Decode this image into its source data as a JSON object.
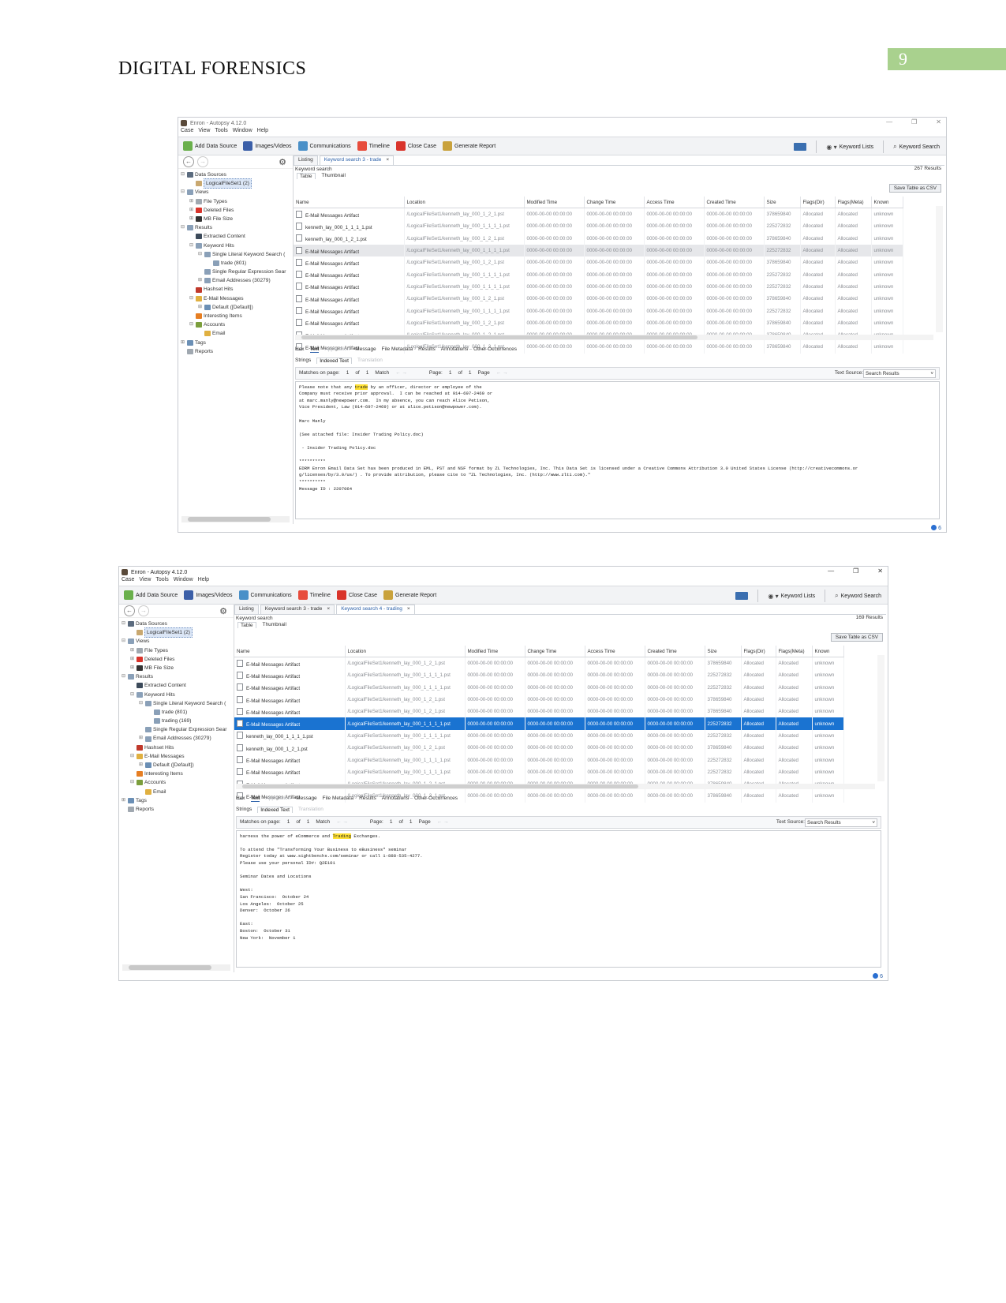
{
  "header": {
    "title": "DIGITAL FORENSICS",
    "page_number": "9"
  },
  "menu": [
    "Case",
    "View",
    "Tools",
    "Window",
    "Help"
  ],
  "toolbar": {
    "add_data_source": "Add Data Source",
    "images_videos": "Images/Videos",
    "communications": "Communications",
    "timeline": "Timeline",
    "close_case": "Close Case",
    "generate_report": "Generate Report",
    "keyword_lists": "Keyword Lists",
    "keyword_search": "Keyword Search"
  },
  "columns": [
    "Name",
    "Location",
    "Modified Time",
    "Change Time",
    "Access Time",
    "Created Time",
    "Size",
    "Flags(Dir)",
    "Flags(Meta)",
    "Known"
  ],
  "common": {
    "keyword_search_label": "Keyword search",
    "table_tab": "Table",
    "thumbnail_tab": "Thumbnail",
    "save_csv": "Save Table as CSV",
    "lower_tabs": [
      "Hex",
      "Text",
      "Application",
      "Message",
      "File Metadata",
      "Results",
      "Annotations",
      "Other Occurrences"
    ],
    "inner_tabs": [
      "Strings",
      "Indexed Text",
      "Translation"
    ],
    "matches_label": "Matches on page:",
    "of": "of",
    "match": "Match",
    "page_label": "Page:",
    "page_word": "Page",
    "text_source_label": "Text Source:",
    "text_source_value": "Search Results",
    "status_count": "6"
  },
  "screenshot1": {
    "window_title": "Enron - Autopsy 4.12.0",
    "tabs": [
      {
        "label": "Listing",
        "active": false,
        "closable": false
      },
      {
        "label": "Keyword search 3 - trade",
        "active": true,
        "closable": true
      }
    ],
    "results_count": "267  Results",
    "tree": [
      {
        "level": 0,
        "toggle": "⊟",
        "label": "Data Sources",
        "icon": "#5b6b7e"
      },
      {
        "level": 1,
        "toggle": "",
        "label": "LogicalFileSet1 (2)",
        "icon": "#c9a870",
        "selected": true
      },
      {
        "level": 0,
        "toggle": "⊟",
        "label": "Views",
        "icon": "#8aa0b8"
      },
      {
        "level": 1,
        "toggle": "⊞",
        "label": "File Types",
        "icon": "#a0a8b0"
      },
      {
        "level": 1,
        "toggle": "⊞",
        "label": "Deleted Files",
        "icon": "#d9342b"
      },
      {
        "level": 1,
        "toggle": "⊞",
        "label": "MB File Size",
        "icon": "#333"
      },
      {
        "level": 0,
        "toggle": "⊟",
        "label": "Results",
        "icon": "#8aa0b8"
      },
      {
        "level": 1,
        "toggle": "",
        "label": "Extracted Content",
        "icon": "#3c4a5a"
      },
      {
        "level": 1,
        "toggle": "⊟",
        "label": "Keyword Hits",
        "icon": "#8aa0b8"
      },
      {
        "level": 2,
        "toggle": "⊟",
        "label": "Single Literal Keyword Search (",
        "icon": "#8aa0b8"
      },
      {
        "level": 3,
        "toggle": "",
        "label": "trade (801)",
        "icon": "#8aa0b8"
      },
      {
        "level": 2,
        "toggle": "",
        "label": "Single Regular Expression Sear",
        "icon": "#8aa0b8"
      },
      {
        "level": 2,
        "toggle": "⊞",
        "label": "Email Addresses (30279)",
        "icon": "#8aa0b8"
      },
      {
        "level": 1,
        "toggle": "",
        "label": "Hashset Hits",
        "icon": "#c0392b"
      },
      {
        "level": 1,
        "toggle": "⊟",
        "label": "E-Mail Messages",
        "icon": "#e0b040"
      },
      {
        "level": 2,
        "toggle": "⊞",
        "label": "Default ([Default])",
        "icon": "#6b8fb5"
      },
      {
        "level": 1,
        "toggle": "",
        "label": "Interesting Items",
        "icon": "#e67e22"
      },
      {
        "level": 1,
        "toggle": "⊟",
        "label": "Accounts",
        "icon": "#7b9e3c"
      },
      {
        "level": 2,
        "toggle": "",
        "label": "Email",
        "icon": "#e0b040"
      },
      {
        "level": 0,
        "toggle": "⊞",
        "label": "Tags",
        "icon": "#6b8fb5"
      },
      {
        "level": 0,
        "toggle": "",
        "label": "Reports",
        "icon": "#a0a8b0"
      }
    ],
    "rows": [
      {
        "name": "E-Mail Messages Artifact",
        "location": "/LogicalFileSet1/kenneth_lay_000_1_2_1.pst",
        "modified": "0000-00-00 00:00:00",
        "change": "0000-00-00 00:00:00",
        "access": "0000-00-00 00:00:00",
        "created": "0000-00-00 00:00:00",
        "size": "378659840",
        "flags_dir": "Allocated",
        "flags_meta": "Allocated",
        "known": "unknown",
        "state": ""
      },
      {
        "name": "kenneth_lay_000_1_1_1_1.pst",
        "location": "/LogicalFileSet1/kenneth_lay_000_1_1_1_1.pst",
        "modified": "0000-00-00 00:00:00",
        "change": "0000-00-00 00:00:00",
        "access": "0000-00-00 00:00:00",
        "created": "0000-00-00 00:00:00",
        "size": "225272832",
        "flags_dir": "Allocated",
        "flags_meta": "Allocated",
        "known": "unknown",
        "state": ""
      },
      {
        "name": "kenneth_lay_000_1_2_1.pst",
        "location": "/LogicalFileSet1/kenneth_lay_000_1_2_1.pst",
        "modified": "0000-00-00 00:00:00",
        "change": "0000-00-00 00:00:00",
        "access": "0000-00-00 00:00:00",
        "created": "0000-00-00 00:00:00",
        "size": "378659840",
        "flags_dir": "Allocated",
        "flags_meta": "Allocated",
        "known": "unknown",
        "state": ""
      },
      {
        "name": "E-Mail Messages Artifact",
        "location": "/LogicalFileSet1/kenneth_lay_000_1_1_1_1.pst",
        "modified": "0000-00-00 00:00:00",
        "change": "0000-00-00 00:00:00",
        "access": "0000-00-00 00:00:00",
        "created": "0000-00-00 00:00:00",
        "size": "225272832",
        "flags_dir": "Allocated",
        "flags_meta": "Allocated",
        "known": "unknown",
        "state": "hl"
      },
      {
        "name": "E-Mail Messages Artifact",
        "location": "/LogicalFileSet1/kenneth_lay_000_1_2_1.pst",
        "modified": "0000-00-00 00:00:00",
        "change": "0000-00-00 00:00:00",
        "access": "0000-00-00 00:00:00",
        "created": "0000-00-00 00:00:00",
        "size": "378659840",
        "flags_dir": "Allocated",
        "flags_meta": "Allocated",
        "known": "unknown",
        "state": ""
      },
      {
        "name": "E-Mail Messages Artifact",
        "location": "/LogicalFileSet1/kenneth_lay_000_1_1_1_1.pst",
        "modified": "0000-00-00 00:00:00",
        "change": "0000-00-00 00:00:00",
        "access": "0000-00-00 00:00:00",
        "created": "0000-00-00 00:00:00",
        "size": "225272832",
        "flags_dir": "Allocated",
        "flags_meta": "Allocated",
        "known": "unknown",
        "state": ""
      },
      {
        "name": "E-Mail Messages Artifact",
        "location": "/LogicalFileSet1/kenneth_lay_000_1_1_1_1.pst",
        "modified": "0000-00-00 00:00:00",
        "change": "0000-00-00 00:00:00",
        "access": "0000-00-00 00:00:00",
        "created": "0000-00-00 00:00:00",
        "size": "225272832",
        "flags_dir": "Allocated",
        "flags_meta": "Allocated",
        "known": "unknown",
        "state": ""
      },
      {
        "name": "E-Mail Messages Artifact",
        "location": "/LogicalFileSet1/kenneth_lay_000_1_2_1.pst",
        "modified": "0000-00-00 00:00:00",
        "change": "0000-00-00 00:00:00",
        "access": "0000-00-00 00:00:00",
        "created": "0000-00-00 00:00:00",
        "size": "378659840",
        "flags_dir": "Allocated",
        "flags_meta": "Allocated",
        "known": "unknown",
        "state": ""
      },
      {
        "name": "E-Mail Messages Artifact",
        "location": "/LogicalFileSet1/kenneth_lay_000_1_1_1_1.pst",
        "modified": "0000-00-00 00:00:00",
        "change": "0000-00-00 00:00:00",
        "access": "0000-00-00 00:00:00",
        "created": "0000-00-00 00:00:00",
        "size": "225272832",
        "flags_dir": "Allocated",
        "flags_meta": "Allocated",
        "known": "unknown",
        "state": ""
      },
      {
        "name": "E-Mail Messages Artifact",
        "location": "/LogicalFileSet1/kenneth_lay_000_1_2_1.pst",
        "modified": "0000-00-00 00:00:00",
        "change": "0000-00-00 00:00:00",
        "access": "0000-00-00 00:00:00",
        "created": "0000-00-00 00:00:00",
        "size": "378659840",
        "flags_dir": "Allocated",
        "flags_meta": "Allocated",
        "known": "unknown",
        "state": ""
      },
      {
        "name": "E-Mail Messages Artifact",
        "location": "/LogicalFileSet1/kenneth_lay_000_1_2_1.pst",
        "modified": "0000-00-00 00:00:00",
        "change": "0000-00-00 00:00:00",
        "access": "0000-00-00 00:00:00",
        "created": "0000-00-00 00:00:00",
        "size": "378659840",
        "flags_dir": "Allocated",
        "flags_meta": "Allocated",
        "known": "unknown",
        "state": ""
      },
      {
        "name": "E-Mail Messages Artifact",
        "location": "/LogicalFileSet1/kenneth_lay_000_1_2_1.pst",
        "modified": "0000-00-00 00:00:00",
        "change": "0000-00-00 00:00:00",
        "access": "0000-00-00 00:00:00",
        "created": "0000-00-00 00:00:00",
        "size": "378659840",
        "flags_dir": "Allocated",
        "flags_meta": "Allocated",
        "known": "unknown",
        "state": ""
      }
    ],
    "matches": {
      "current": "1",
      "total": "1"
    },
    "page": {
      "current": "1",
      "total": "1"
    },
    "text_before": "Please note that any ",
    "highlight": "trade",
    "text_after": " by an officer, director or employee of the\nCompany must receive prior approval.  I can be reached at 914-697-2460 or\nat marc.manly@newpower.com.  In my absence, you can reach Alice Petison,\nVice President, Law (914-697-2469) or at alice.petison@newpower.com).\n\nMarc Manly\n\n(See attached file: Insider Trading Policy.doc)\n\n - Insider Trading Policy.doc\n\n**********\nEDRM Enron Email Data Set has been produced in EML, PST and NSF format by ZL Technologies, Inc. This Data Set is licensed under a Creative Commons Attribution 3.0 United States License (http://creativecommons.or\ng/licenses/by/3.0/us/) . To provide attribution, please cite to \"ZL Technologies, Inc. (http://www.zlti.com).\"\n**********\nMessage ID : 2207064"
  },
  "screenshot2": {
    "window_title": "Enron - Autopsy 4.12.0",
    "tabs": [
      {
        "label": "Listing",
        "active": false,
        "closable": false
      },
      {
        "label": "Keyword search 3 - trade",
        "active": false,
        "closable": true
      },
      {
        "label": "Keyword search 4 - trading",
        "active": true,
        "closable": true
      }
    ],
    "results_count": "169  Results",
    "tree": [
      {
        "level": 0,
        "toggle": "⊟",
        "label": "Data Sources",
        "icon": "#5b6b7e"
      },
      {
        "level": 1,
        "toggle": "",
        "label": "LogicalFileSet1 (2)",
        "icon": "#c9a870",
        "selected": true
      },
      {
        "level": 0,
        "toggle": "⊟",
        "label": "Views",
        "icon": "#8aa0b8"
      },
      {
        "level": 1,
        "toggle": "⊞",
        "label": "File Types",
        "icon": "#a0a8b0"
      },
      {
        "level": 1,
        "toggle": "⊞",
        "label": "Deleted Files",
        "icon": "#d9342b"
      },
      {
        "level": 1,
        "toggle": "⊞",
        "label": "MB File Size",
        "icon": "#333"
      },
      {
        "level": 0,
        "toggle": "⊟",
        "label": "Results",
        "icon": "#8aa0b8"
      },
      {
        "level": 1,
        "toggle": "",
        "label": "Extracted Content",
        "icon": "#3c4a5a"
      },
      {
        "level": 1,
        "toggle": "⊟",
        "label": "Keyword Hits",
        "icon": "#8aa0b8"
      },
      {
        "level": 2,
        "toggle": "⊟",
        "label": "Single Literal Keyword Search (",
        "icon": "#8aa0b8"
      },
      {
        "level": 3,
        "toggle": "",
        "label": "trade (801)",
        "icon": "#8aa0b8"
      },
      {
        "level": 3,
        "toggle": "",
        "label": "trading (169)",
        "icon": "#8aa0b8"
      },
      {
        "level": 2,
        "toggle": "",
        "label": "Single Regular Expression Sear",
        "icon": "#8aa0b8"
      },
      {
        "level": 2,
        "toggle": "⊞",
        "label": "Email Addresses (30279)",
        "icon": "#8aa0b8"
      },
      {
        "level": 1,
        "toggle": "",
        "label": "Hashset Hits",
        "icon": "#c0392b"
      },
      {
        "level": 1,
        "toggle": "⊟",
        "label": "E-Mail Messages",
        "icon": "#e0b040"
      },
      {
        "level": 2,
        "toggle": "⊞",
        "label": "Default ([Default])",
        "icon": "#6b8fb5"
      },
      {
        "level": 1,
        "toggle": "",
        "label": "Interesting Items",
        "icon": "#e67e22"
      },
      {
        "level": 1,
        "toggle": "⊟",
        "label": "Accounts",
        "icon": "#7b9e3c"
      },
      {
        "level": 2,
        "toggle": "",
        "label": "Email",
        "icon": "#e0b040"
      },
      {
        "level": 0,
        "toggle": "⊞",
        "label": "Tags",
        "icon": "#6b8fb5"
      },
      {
        "level": 0,
        "toggle": "",
        "label": "Reports",
        "icon": "#a0a8b0"
      }
    ],
    "rows": [
      {
        "name": "E-Mail Messages Artifact",
        "location": "/LogicalFileSet1/kenneth_lay_000_1_2_1.pst",
        "modified": "0000-00-00 00:00:00",
        "change": "0000-00-00 00:00:00",
        "access": "0000-00-00 00:00:00",
        "created": "0000-00-00 00:00:00",
        "size": "378659840",
        "flags_dir": "Allocated",
        "flags_meta": "Allocated",
        "known": "unknown",
        "state": ""
      },
      {
        "name": "E-Mail Messages Artifact",
        "location": "/LogicalFileSet1/kenneth_lay_000_1_1_1_1.pst",
        "modified": "0000-00-00 00:00:00",
        "change": "0000-00-00 00:00:00",
        "access": "0000-00-00 00:00:00",
        "created": "0000-00-00 00:00:00",
        "size": "225272832",
        "flags_dir": "Allocated",
        "flags_meta": "Allocated",
        "known": "unknown",
        "state": ""
      },
      {
        "name": "E-Mail Messages Artifact",
        "location": "/LogicalFileSet1/kenneth_lay_000_1_1_1_1.pst",
        "modified": "0000-00-00 00:00:00",
        "change": "0000-00-00 00:00:00",
        "access": "0000-00-00 00:00:00",
        "created": "0000-00-00 00:00:00",
        "size": "225272832",
        "flags_dir": "Allocated",
        "flags_meta": "Allocated",
        "known": "unknown",
        "state": ""
      },
      {
        "name": "E-Mail Messages Artifact",
        "location": "/LogicalFileSet1/kenneth_lay_000_1_2_1.pst",
        "modified": "0000-00-00 00:00:00",
        "change": "0000-00-00 00:00:00",
        "access": "0000-00-00 00:00:00",
        "created": "0000-00-00 00:00:00",
        "size": "378659840",
        "flags_dir": "Allocated",
        "flags_meta": "Allocated",
        "known": "unknown",
        "state": ""
      },
      {
        "name": "E-Mail Messages Artifact",
        "location": "/LogicalFileSet1/kenneth_lay_000_1_2_1.pst",
        "modified": "0000-00-00 00:00:00",
        "change": "0000-00-00 00:00:00",
        "access": "0000-00-00 00:00:00",
        "created": "0000-00-00 00:00:00",
        "size": "378659840",
        "flags_dir": "Allocated",
        "flags_meta": "Allocated",
        "known": "unknown",
        "state": ""
      },
      {
        "name": "E-Mail Messages Artifact",
        "location": "/LogicalFileSet1/kenneth_lay_000_1_1_1_1.pst",
        "modified": "0000-00-00 00:00:00",
        "change": "0000-00-00 00:00:00",
        "access": "0000-00-00 00:00:00",
        "created": "0000-00-00 00:00:00",
        "size": "225272832",
        "flags_dir": "Allocated",
        "flags_meta": "Allocated",
        "known": "unknown",
        "state": "sel"
      },
      {
        "name": "kenneth_lay_000_1_1_1_1.pst",
        "location": "/LogicalFileSet1/kenneth_lay_000_1_1_1_1.pst",
        "modified": "0000-00-00 00:00:00",
        "change": "0000-00-00 00:00:00",
        "access": "0000-00-00 00:00:00",
        "created": "0000-00-00 00:00:00",
        "size": "225272832",
        "flags_dir": "Allocated",
        "flags_meta": "Allocated",
        "known": "unknown",
        "state": ""
      },
      {
        "name": "kenneth_lay_000_1_2_1.pst",
        "location": "/LogicalFileSet1/kenneth_lay_000_1_2_1.pst",
        "modified": "0000-00-00 00:00:00",
        "change": "0000-00-00 00:00:00",
        "access": "0000-00-00 00:00:00",
        "created": "0000-00-00 00:00:00",
        "size": "378659840",
        "flags_dir": "Allocated",
        "flags_meta": "Allocated",
        "known": "unknown",
        "state": ""
      },
      {
        "name": "E-Mail Messages Artifact",
        "location": "/LogicalFileSet1/kenneth_lay_000_1_1_1_1.pst",
        "modified": "0000-00-00 00:00:00",
        "change": "0000-00-00 00:00:00",
        "access": "0000-00-00 00:00:00",
        "created": "0000-00-00 00:00:00",
        "size": "225272832",
        "flags_dir": "Allocated",
        "flags_meta": "Allocated",
        "known": "unknown",
        "state": ""
      },
      {
        "name": "E-Mail Messages Artifact",
        "location": "/LogicalFileSet1/kenneth_lay_000_1_1_1_1.pst",
        "modified": "0000-00-00 00:00:00",
        "change": "0000-00-00 00:00:00",
        "access": "0000-00-00 00:00:00",
        "created": "0000-00-00 00:00:00",
        "size": "225272832",
        "flags_dir": "Allocated",
        "flags_meta": "Allocated",
        "known": "unknown",
        "state": ""
      },
      {
        "name": "E-Mail Messages Artifact",
        "location": "/LogicalFileSet1/kenneth_lay_000_1_2_1.pst",
        "modified": "0000-00-00 00:00:00",
        "change": "0000-00-00 00:00:00",
        "access": "0000-00-00 00:00:00",
        "created": "0000-00-00 00:00:00",
        "size": "378659840",
        "flags_dir": "Allocated",
        "flags_meta": "Allocated",
        "known": "unknown",
        "state": ""
      },
      {
        "name": "E-Mail Messages Artifact",
        "location": "/LogicalFileSet1/kenneth_lay_000_1_2_1.pst",
        "modified": "0000-00-00 00:00:00",
        "change": "0000-00-00 00:00:00",
        "access": "0000-00-00 00:00:00",
        "created": "0000-00-00 00:00:00",
        "size": "378659840",
        "flags_dir": "Allocated",
        "flags_meta": "Allocated",
        "known": "unknown",
        "state": ""
      }
    ],
    "matches": {
      "current": "1",
      "total": "1"
    },
    "page": {
      "current": "1",
      "total": "1"
    },
    "text_before": "harness the power of eCommerce and ",
    "highlight": "Trading",
    "text_after": " Exchanges.\n\nTo attend the \"Transforming Your Business to eBusiness\" seminar\nRegister today at www.sightbenchs.com/seminar or call 1-888-535-4277.\nPlease use your personal ID#: Q2E101\n\nSeminar Dates and Locations\n\nWest:\nSan Francisco:  October 24\nLos Angeles:  October 25\nDenver:  October 26\n\nEast:\nBoston:  October 31\nNew York:  November 1"
  }
}
